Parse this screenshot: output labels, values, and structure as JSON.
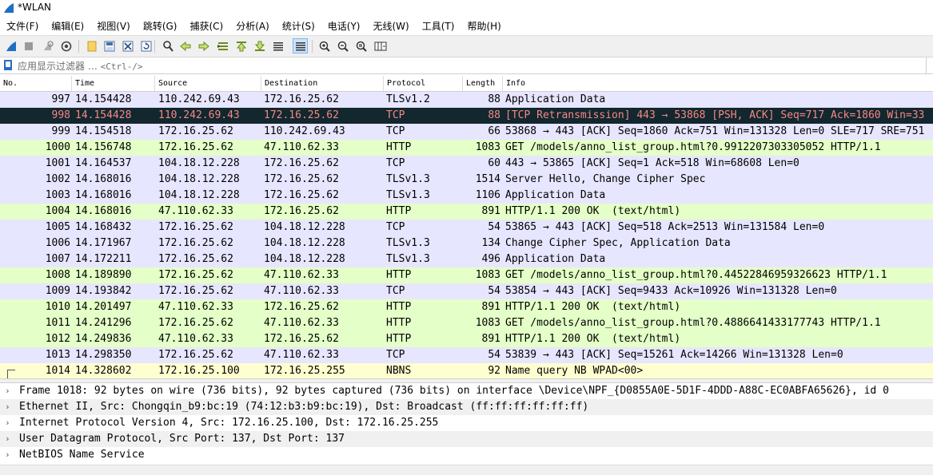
{
  "window": {
    "title": "*WLAN"
  },
  "menu": [
    "文件(F)",
    "编辑(E)",
    "视图(V)",
    "跳转(G)",
    "捕获(C)",
    "分析(A)",
    "统计(S)",
    "电话(Y)",
    "无线(W)",
    "工具(T)",
    "帮助(H)"
  ],
  "toolbar_icons": [
    "shark-fin-start-icon",
    "stop-icon",
    "restart-icon",
    "capture-options-icon",
    "open-file-icon",
    "save-file-icon",
    "close-file-icon",
    "reload-icon",
    "find-packet-icon",
    "go-back-icon",
    "go-forward-icon",
    "go-to-packet-icon",
    "go-first-icon",
    "go-last-icon",
    "autoscroll-icon",
    "colorize-icon",
    "zoom-in-icon",
    "zoom-out-icon",
    "zoom-normal-icon",
    "resize-columns-icon"
  ],
  "filter": {
    "placeholder": "应用显示过滤器 … ",
    "shortcut": "<Ctrl-/>"
  },
  "columns": [
    "No.",
    "Time",
    "Source",
    "Destination",
    "Protocol",
    "Length",
    "Info"
  ],
  "packets": [
    {
      "no": "997",
      "time": "14.154428",
      "src": "110.242.69.43",
      "dst": "172.16.25.62",
      "proto": "TLSv1.2",
      "len": "88",
      "info": "Application Data",
      "color": "tcp"
    },
    {
      "no": "998",
      "time": "14.154428",
      "src": "110.242.69.43",
      "dst": "172.16.25.62",
      "proto": "TCP",
      "len": "88",
      "info": "[TCP Retransmission] 443 → 53868 [PSH, ACK] Seq=717 Ack=1860 Win=33",
      "color": "sel"
    },
    {
      "no": "999",
      "time": "14.154518",
      "src": "172.16.25.62",
      "dst": "110.242.69.43",
      "proto": "TCP",
      "len": "66",
      "info": "53868 → 443 [ACK] Seq=1860 Ack=751 Win=131328 Len=0 SLE=717 SRE=751",
      "color": "tcp"
    },
    {
      "no": "1000",
      "time": "14.156748",
      "src": "172.16.25.62",
      "dst": "47.110.62.33",
      "proto": "HTTP",
      "len": "1083",
      "info": "GET /models/anno_list_group.html?0.9912207303305052 HTTP/1.1",
      "color": "http"
    },
    {
      "no": "1001",
      "time": "14.164537",
      "src": "104.18.12.228",
      "dst": "172.16.25.62",
      "proto": "TCP",
      "len": "60",
      "info": "443 → 53865 [ACK] Seq=1 Ack=518 Win=68608 Len=0",
      "color": "tcp"
    },
    {
      "no": "1002",
      "time": "14.168016",
      "src": "104.18.12.228",
      "dst": "172.16.25.62",
      "proto": "TLSv1.3",
      "len": "1514",
      "info": "Server Hello, Change Cipher Spec",
      "color": "tcp"
    },
    {
      "no": "1003",
      "time": "14.168016",
      "src": "104.18.12.228",
      "dst": "172.16.25.62",
      "proto": "TLSv1.3",
      "len": "1106",
      "info": "Application Data",
      "color": "tcp"
    },
    {
      "no": "1004",
      "time": "14.168016",
      "src": "47.110.62.33",
      "dst": "172.16.25.62",
      "proto": "HTTP",
      "len": "891",
      "info": "HTTP/1.1 200 OK  (text/html)",
      "color": "http"
    },
    {
      "no": "1005",
      "time": "14.168432",
      "src": "172.16.25.62",
      "dst": "104.18.12.228",
      "proto": "TCP",
      "len": "54",
      "info": "53865 → 443 [ACK] Seq=518 Ack=2513 Win=131584 Len=0",
      "color": "tcp"
    },
    {
      "no": "1006",
      "time": "14.171967",
      "src": "172.16.25.62",
      "dst": "104.18.12.228",
      "proto": "TLSv1.3",
      "len": "134",
      "info": "Change Cipher Spec, Application Data",
      "color": "tcp"
    },
    {
      "no": "1007",
      "time": "14.172211",
      "src": "172.16.25.62",
      "dst": "104.18.12.228",
      "proto": "TLSv1.3",
      "len": "496",
      "info": "Application Data",
      "color": "tcp"
    },
    {
      "no": "1008",
      "time": "14.189890",
      "src": "172.16.25.62",
      "dst": "47.110.62.33",
      "proto": "HTTP",
      "len": "1083",
      "info": "GET /models/anno_list_group.html?0.44522846959326623 HTTP/1.1",
      "color": "http"
    },
    {
      "no": "1009",
      "time": "14.193842",
      "src": "172.16.25.62",
      "dst": "47.110.62.33",
      "proto": "TCP",
      "len": "54",
      "info": "53854 → 443 [ACK] Seq=9433 Ack=10926 Win=131328 Len=0",
      "color": "tcp"
    },
    {
      "no": "1010",
      "time": "14.201497",
      "src": "47.110.62.33",
      "dst": "172.16.25.62",
      "proto": "HTTP",
      "len": "891",
      "info": "HTTP/1.1 200 OK  (text/html)",
      "color": "http"
    },
    {
      "no": "1011",
      "time": "14.241296",
      "src": "172.16.25.62",
      "dst": "47.110.62.33",
      "proto": "HTTP",
      "len": "1083",
      "info": "GET /models/anno_list_group.html?0.4886641433177743 HTTP/1.1",
      "color": "http"
    },
    {
      "no": "1012",
      "time": "14.249836",
      "src": "47.110.62.33",
      "dst": "172.16.25.62",
      "proto": "HTTP",
      "len": "891",
      "info": "HTTP/1.1 200 OK  (text/html)",
      "color": "http"
    },
    {
      "no": "1013",
      "time": "14.298350",
      "src": "172.16.25.62",
      "dst": "47.110.62.33",
      "proto": "TCP",
      "len": "54",
      "info": "53839 → 443 [ACK] Seq=15261 Ack=14266 Win=131328 Len=0",
      "color": "tcp"
    },
    {
      "no": "1014",
      "time": "14.328602",
      "src": "172.16.25.100",
      "dst": "172.16.25.255",
      "proto": "NBNS",
      "len": "92",
      "info": "Name query NB WPAD<00>",
      "color": "nbns"
    }
  ],
  "details": [
    "Frame 1018: 92 bytes on wire (736 bits), 92 bytes captured (736 bits) on interface \\Device\\NPF_{D0855A0E-5D1F-4DDD-A88C-EC0ABFA65626}, id 0",
    "Ethernet II, Src: Chongqin_b9:bc:19 (74:12:b3:b9:bc:19), Dst: Broadcast (ff:ff:ff:ff:ff:ff)",
    "Internet Protocol Version 4, Src: 172.16.25.100, Dst: 172.16.25.255",
    "User Datagram Protocol, Src Port: 137, Dst Port: 137",
    "NetBIOS Name Service"
  ],
  "colors": {
    "tcp_row": "#e7e6ff",
    "http_row": "#e4ffc7",
    "nbns_row": "#feffd0",
    "selected_row_bg": "#12272e",
    "selected_row_fg": "#f78787",
    "accent_blue": "#2b6cc4"
  }
}
